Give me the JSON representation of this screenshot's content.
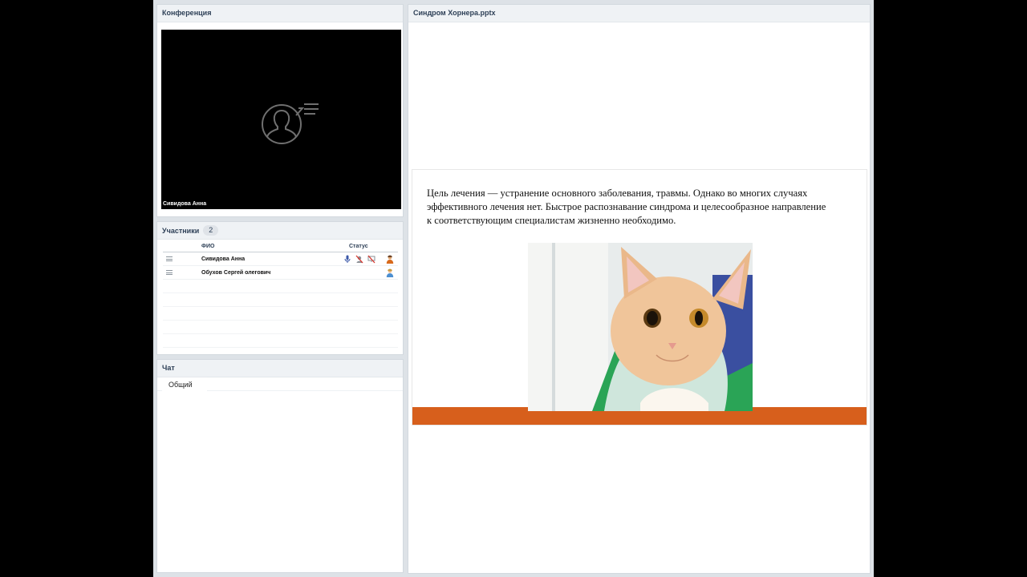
{
  "conference": {
    "title": "Конференция",
    "video_name": "Сивидова Анна"
  },
  "participants": {
    "title": "Участники",
    "count": "2",
    "columns": {
      "fio": "ФИО",
      "status": "Статус"
    },
    "rows": [
      {
        "name": "Сивидова Анна",
        "icons": [
          "microphone-icon",
          "camera-off-icon",
          "screen-share-off-icon",
          "presenter-avatar-icon"
        ]
      },
      {
        "name": "Обухов Сергей  олегович",
        "icons": [
          "user-avatar-icon"
        ]
      }
    ]
  },
  "chat": {
    "title": "Чат",
    "tab": "Общий"
  },
  "presentation": {
    "title": "Синдром Хорнеpа.pptx",
    "slide_text": "Цель лечения — устранение основного заболевания, травмы. Однако во многих случаях эффективного лечения нет. Быстрое распознавание синдрома и целесообразное направление к соответствующим специалистам  жизненно необходимо.",
    "accent_color": "#d75f1c"
  }
}
